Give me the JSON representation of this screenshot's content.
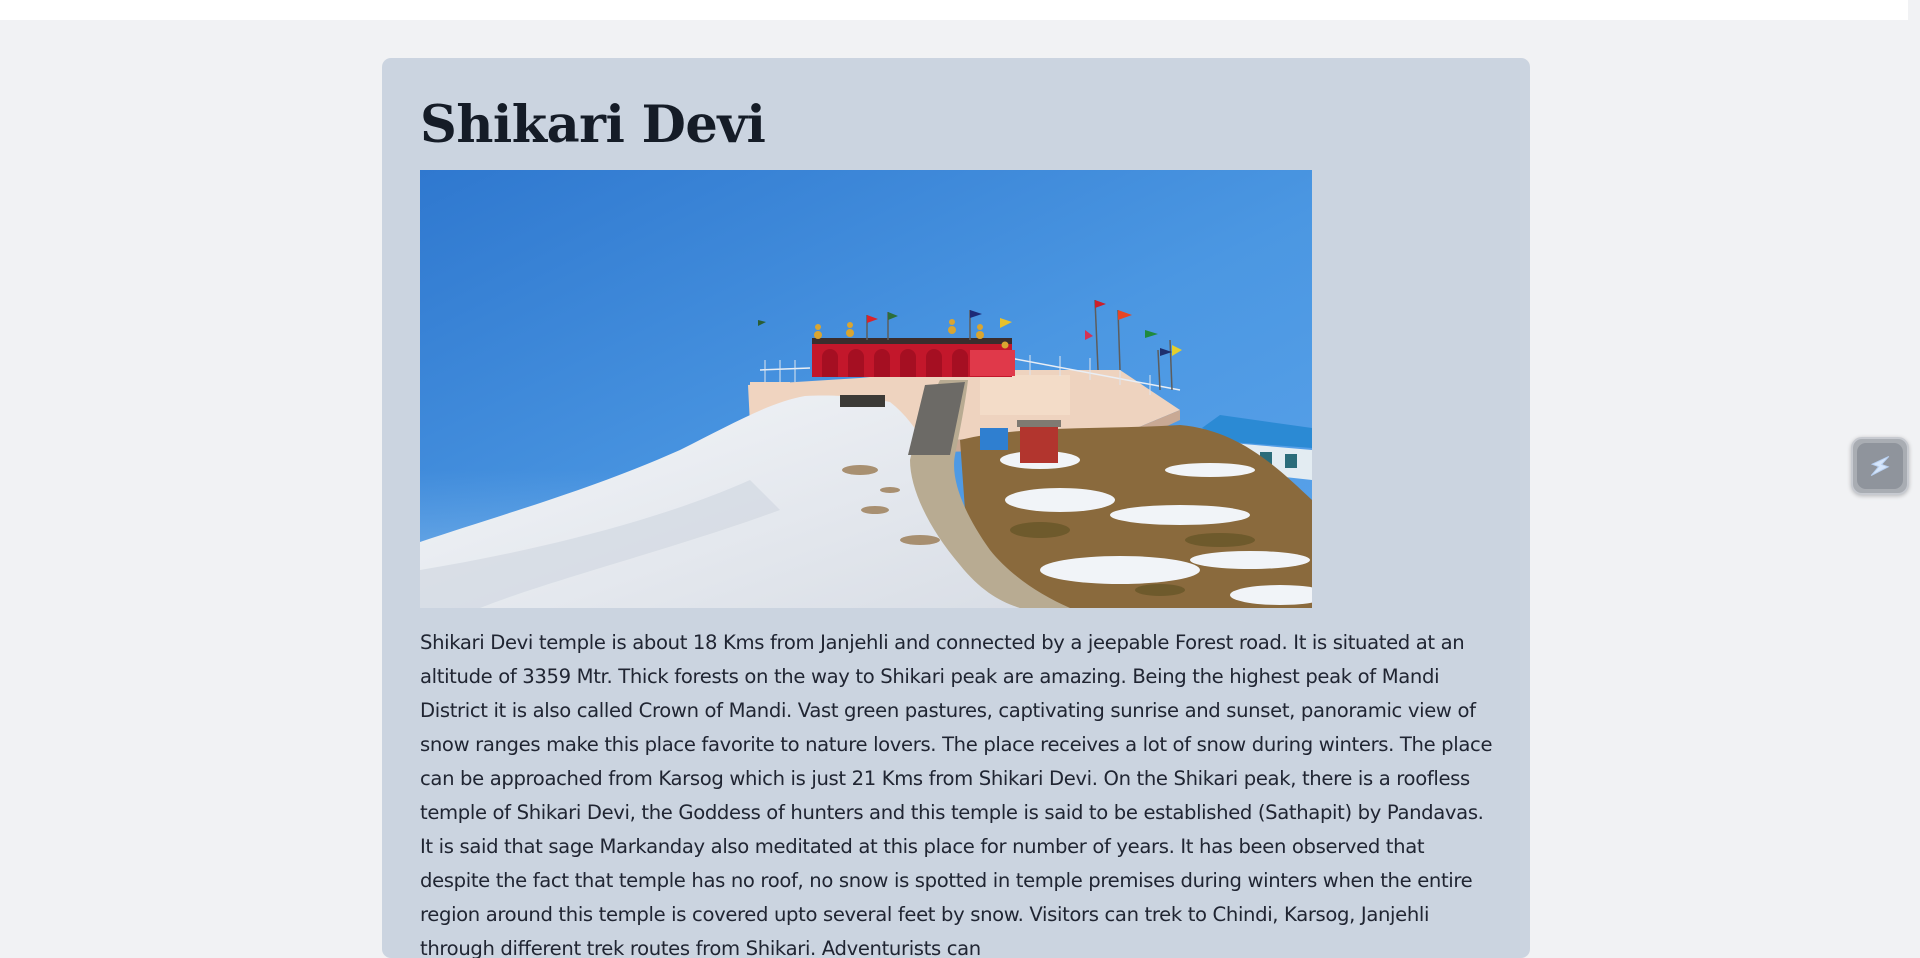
{
  "page": {
    "title": "Shikari Devi",
    "image_alt": "Shikari Devi temple on a snow-covered hill under blue sky",
    "description": "Shikari Devi temple is about 18 Kms from Janjehli and connected by a jeepable Forest road. It is situated at an altitude of 3359 Mtr. Thick forests on the way to Shikari peak are amazing. Being the highest peak of Mandi District it is also called Crown of Mandi. Vast green pastures, captivating sunrise and sunset, panoramic view of snow ranges make this place favorite to nature lovers. The place receives a lot of snow during winters. The place can be approached from Karsog which is just 21 Kms from Shikari Devi. On the Shikari peak, there is a roofless temple of Shikari Devi, the Goddess of hunters and this temple is said to be established (Sathapit) by Pandavas. It is said that sage Markanday also meditated at this place for number of years. It has been observed that despite the fact that temple has no roof, no snow is spotted in temple premises during winters when the entire region around this temple is covered upto several feet by snow. Visitors can trek to Chindi, Karsog, Janjehli through different trek routes from Shikari. Adventurists can"
  },
  "floating_button": {
    "icon": "lightning-icon"
  },
  "colors": {
    "page_bg": "#f1f2f4",
    "card_bg": "#cbd4e0",
    "title": "#151c27",
    "text": "#202532"
  }
}
